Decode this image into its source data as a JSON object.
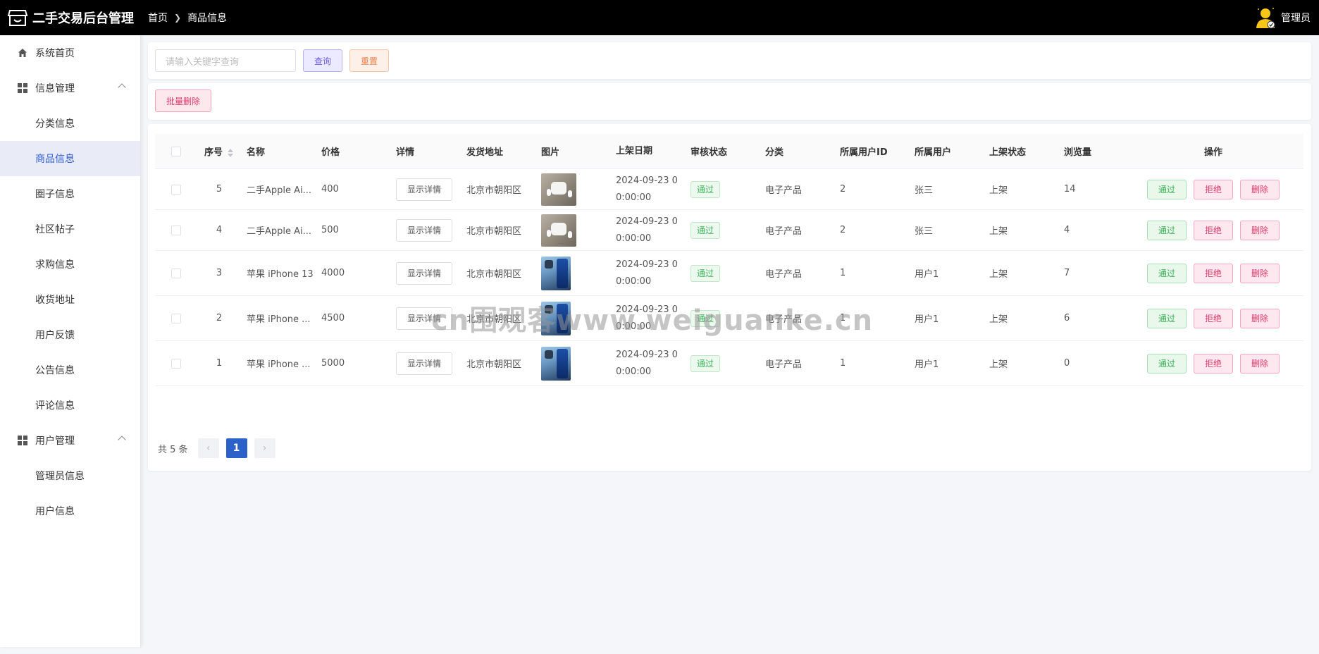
{
  "header": {
    "app_title": "二手交易后台管理",
    "breadcrumb": [
      "首页",
      "商品信息"
    ],
    "user_name": "管理员",
    "logo_icon": "store-icon",
    "avatar_icon": "user-avatar-icon"
  },
  "sidebar": {
    "items": [
      {
        "label": "系统首页",
        "icon": "home-icon",
        "type": "top"
      },
      {
        "label": "信息管理",
        "icon": "grid-icon",
        "type": "group"
      },
      {
        "label": "分类信息",
        "type": "sub"
      },
      {
        "label": "商品信息",
        "type": "sub",
        "active": true
      },
      {
        "label": "圈子信息",
        "type": "sub"
      },
      {
        "label": "社区帖子",
        "type": "sub"
      },
      {
        "label": "求购信息",
        "type": "sub"
      },
      {
        "label": "收货地址",
        "type": "sub"
      },
      {
        "label": "用户反馈",
        "type": "sub"
      },
      {
        "label": "公告信息",
        "type": "sub"
      },
      {
        "label": "评论信息",
        "type": "sub"
      },
      {
        "label": "用户管理",
        "icon": "grid-icon",
        "type": "group"
      },
      {
        "label": "管理员信息",
        "type": "sub"
      },
      {
        "label": "用户信息",
        "type": "sub"
      }
    ]
  },
  "search": {
    "placeholder": "请输入关键字查询",
    "query_label": "查询",
    "reset_label": "重置"
  },
  "toolbar": {
    "batch_delete_label": "批量删除"
  },
  "table": {
    "columns": [
      "序号",
      "名称",
      "价格",
      "详情",
      "发货地址",
      "图片",
      "上架日期",
      "审核状态",
      "分类",
      "所属用户ID",
      "所属用户",
      "上架状态",
      "浏览量",
      "操作"
    ],
    "detail_label": "显示详情",
    "ops": {
      "pass": "通过",
      "reject": "拒绝",
      "delete": "删除"
    },
    "rows": [
      {
        "no": "5",
        "name": "二手Apple Ai...",
        "price": "400",
        "address": "北京市朝阳区",
        "image": "airpods",
        "date_line1": "2024-09-23 0",
        "date_line2": "0:00:00",
        "audit": "通过",
        "category": "电子产品",
        "user_id": "2",
        "user": "张三",
        "state": "上架",
        "views": "14"
      },
      {
        "no": "4",
        "name": "二手Apple Ai...",
        "price": "500",
        "address": "北京市朝阳区",
        "image": "airpods",
        "date_line1": "2024-09-23 0",
        "date_line2": "0:00:00",
        "audit": "通过",
        "category": "电子产品",
        "user_id": "2",
        "user": "张三",
        "state": "上架",
        "views": "4"
      },
      {
        "no": "3",
        "name": "苹果 iPhone 13",
        "price": "4000",
        "address": "北京市朝阳区",
        "image": "phone",
        "date_line1": "2024-09-23 0",
        "date_line2": "0:00:00",
        "audit": "通过",
        "category": "电子产品",
        "user_id": "1",
        "user": "用户1",
        "state": "上架",
        "views": "7"
      },
      {
        "no": "2",
        "name": "苹果 iPhone ...",
        "price": "4500",
        "address": "北京市朝阳区",
        "image": "phone",
        "date_line1": "2024-09-23 0",
        "date_line2": "0:00:00",
        "audit": "通过",
        "category": "电子产品",
        "user_id": "1",
        "user": "用户1",
        "state": "上架",
        "views": "6"
      },
      {
        "no": "1",
        "name": "苹果 iPhone ...",
        "price": "5000",
        "address": "北京市朝阳区",
        "image": "phone",
        "date_line1": "2024-09-23 0",
        "date_line2": "0:00:00",
        "audit": "通过",
        "category": "电子产品",
        "user_id": "1",
        "user": "用户1",
        "state": "上架",
        "views": "0"
      }
    ]
  },
  "pager": {
    "total_text": "共 5 条",
    "current_page": "1",
    "prev_icon": "chevron-left-icon",
    "next_icon": "chevron-right-icon"
  },
  "watermark": "cn围观客www.weiguanke.cn",
  "colors": {
    "header_bg": "#000000",
    "active_menu_bg": "#e9ecf7",
    "primary": "#2a62c9",
    "pass_green": "#35ad52",
    "danger_pink": "#e0396d"
  }
}
